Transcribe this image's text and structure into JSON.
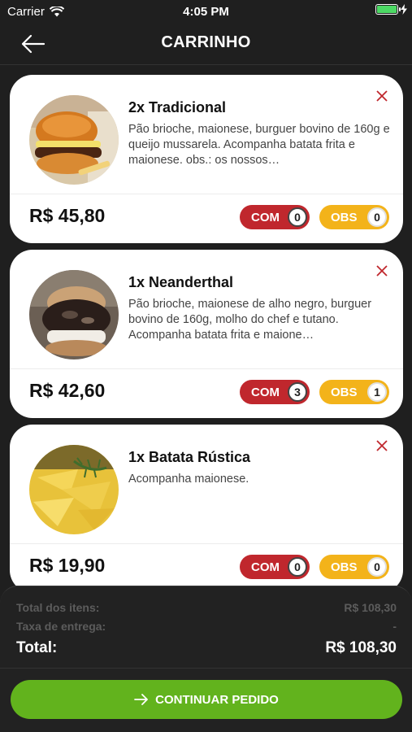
{
  "status_bar": {
    "carrier": "Carrier",
    "time": "4:05 PM",
    "battery_color": "#4cd964"
  },
  "header": {
    "title": "CARRINHO",
    "back_icon": "arrow-left-icon"
  },
  "cart": {
    "items": [
      {
        "name": "2x Tradicional",
        "description": "Pão brioche, maionese, burguer bovino de 160g e queijo mussarela. Acompanha batata frita e maionese.  obs.: os nossos…",
        "price": "R$ 45,80",
        "com_label": "COM",
        "com_count": "0",
        "obs_label": "OBS",
        "obs_count": "0",
        "image": "burger-photo"
      },
      {
        "name": "1x Neanderthal",
        "description": "Pão brioche, maionese de alho negro, burguer bovino de 160g, molho do chef e tutano. Acompanha batata frita e maione…",
        "price": "R$ 42,60",
        "com_label": "COM",
        "com_count": "3",
        "obs_label": "OBS",
        "obs_count": "1",
        "image": "dark-burger-photo"
      },
      {
        "name": "1x Batata Rústica",
        "description": "Acompanha maionese.",
        "price": "R$ 19,90",
        "com_label": "COM",
        "com_count": "0",
        "obs_label": "OBS",
        "obs_count": "0",
        "image": "potato-wedges-photo"
      }
    ]
  },
  "summary": {
    "items_total_label": "Total dos itens:",
    "items_total_value": "R$ 108,30",
    "delivery_fee_label": "Taxa de entrega:",
    "delivery_fee_value": "-",
    "total_label": "Total:",
    "total_value": "R$ 108,30"
  },
  "actions": {
    "continue_label": "CONTINUAR PEDIDO",
    "continue_icon": "arrow-right-icon"
  },
  "colors": {
    "background": "#1f1f1f",
    "com": "#c0272d",
    "obs": "#f3b31a",
    "continue": "#62b31d",
    "remove": "#c0272d"
  }
}
